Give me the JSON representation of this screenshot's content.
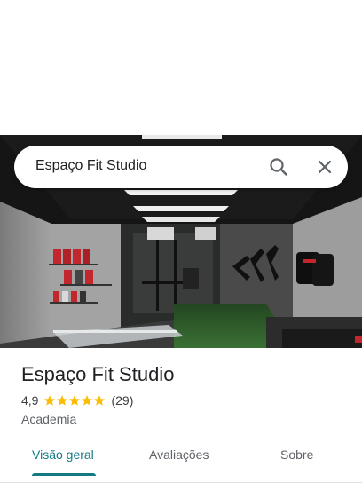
{
  "search": {
    "query": "Espaço Fit Studio"
  },
  "icons": {
    "search": "search-icon",
    "close": "close-icon",
    "star": "star-icon"
  },
  "place": {
    "name": "Espaço Fit Studio",
    "rating": "4,9",
    "stars": 5,
    "reviews": "(29)",
    "category": "Academia"
  },
  "tabs": [
    {
      "label": "Visão geral",
      "active": true
    },
    {
      "label": "Avaliações",
      "active": false
    },
    {
      "label": "Sobre",
      "active": false
    }
  ],
  "colors": {
    "accent": "#137a85",
    "star": "#fbbc04"
  }
}
